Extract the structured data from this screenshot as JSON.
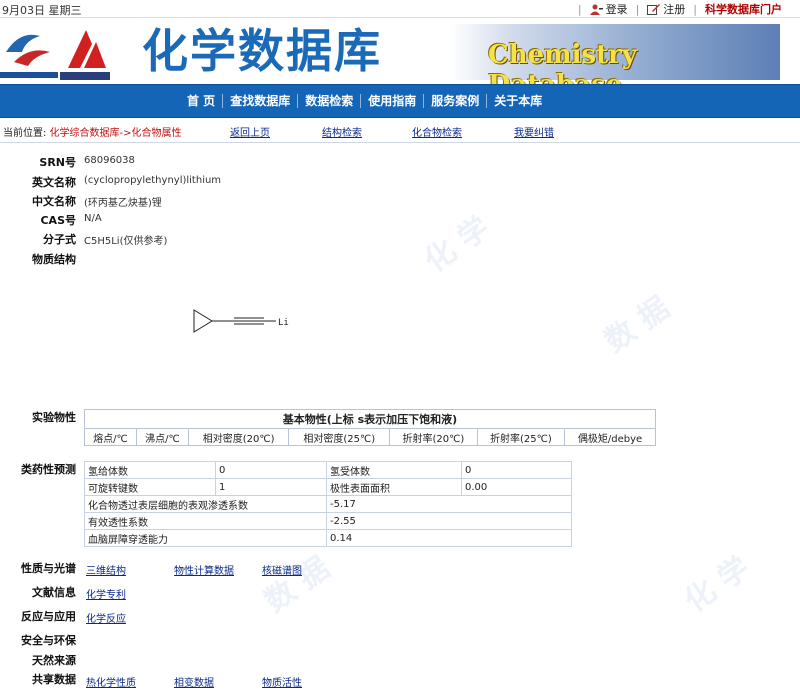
{
  "topbar": {
    "date": "9月03日  星期三",
    "login": "登录",
    "register": "注册",
    "portal": "科学数据库门户"
  },
  "banner": {
    "title": "化学数据库",
    "english_title": "Chemistry Database"
  },
  "nav": {
    "items": [
      "首 页",
      "查找数据库",
      "数据检索",
      "使用指南",
      "服务案例",
      "关于本库"
    ]
  },
  "breadcrumb": {
    "prefix": "当前位置:",
    "path": "化学综合数据库->化合物属性",
    "links": [
      "返回上页",
      "结构检索",
      "化合物检索",
      "我要纠错"
    ]
  },
  "compound": {
    "srn_label": "SRN号",
    "srn": "68096038",
    "en_name_label": "英文名称",
    "en_name": "(cyclopropylethynyl)lithium",
    "cn_name_label": "中文名称",
    "cn_name": "(环丙基乙炔基)锂",
    "cas_label": "CAS号",
    "cas": "N/A",
    "formula_label": "分子式",
    "formula": "C5H5Li(仅供参考)",
    "structure_label": "物质结构",
    "structure_atom": "Li"
  },
  "experimental": {
    "label": "实验物性",
    "table_title": "基本物性(上标 s表示加压下饱和液)",
    "columns": [
      "熔点/℃",
      "沸点/℃",
      "相对密度(20℃)",
      "相对密度(25℃)",
      "折射率(20℃)",
      "折射率(25℃)",
      "偶极矩/debye"
    ]
  },
  "drug_like": {
    "label": "类药性预测",
    "rows": [
      [
        "氢给体数",
        "0",
        "氢受体数",
        "0"
      ],
      [
        "可旋转键数",
        "1",
        "极性表面面积",
        "0.00"
      ]
    ],
    "wide_rows": [
      [
        "化合物透过表层细胞的表观渗透系数",
        "-5.17"
      ],
      [
        "有效透性系数",
        "-2.55"
      ],
      [
        "血脑屏障穿透能力",
        "0.14"
      ]
    ]
  },
  "sections": {
    "properties_label": "性质与光谱",
    "properties_links": [
      "三维结构",
      "物性计算数据",
      "核磁谱图"
    ],
    "literature_label": "文献信息",
    "literature_links": [
      "化学专利"
    ],
    "reaction_label": "反应与应用",
    "reaction_links": [
      "化学反应"
    ],
    "safety_label": "安全与环保",
    "natural_label": "天然来源",
    "shared_label": "共享数据",
    "shared_links": [
      "热化学性质",
      "相变数据",
      "物质活性"
    ]
  },
  "colors": {
    "nav_bg": "#1565b6",
    "title_blue": "#1b6ab8",
    "portal_red": "#b00000",
    "link_blue": "#0a2a8a"
  }
}
